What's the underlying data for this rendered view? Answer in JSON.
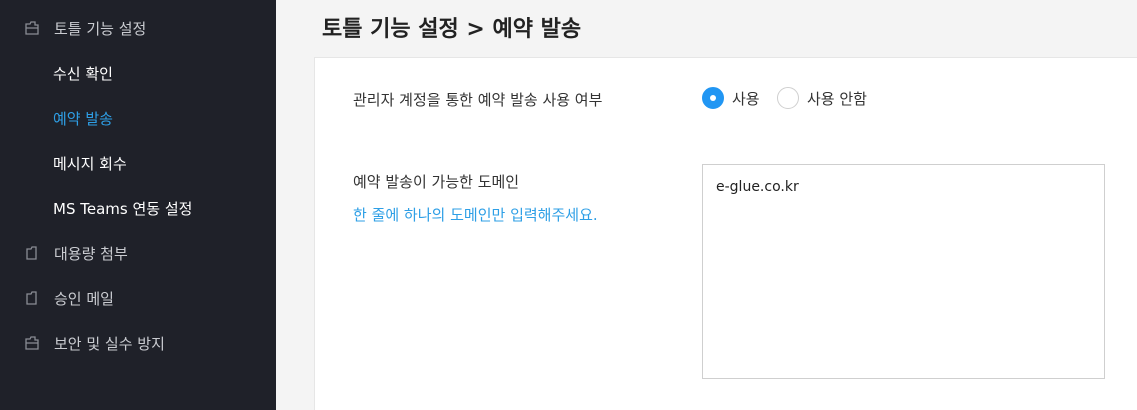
{
  "sidebar": {
    "items": [
      {
        "label": "토틀 기능 설정",
        "icon": "folder-open-icon"
      },
      {
        "label": "대용량 첨부",
        "icon": "folder-icon"
      },
      {
        "label": "승인 메일",
        "icon": "folder-icon"
      },
      {
        "label": "보안 및 실수 방지",
        "icon": "folder-open-icon"
      }
    ],
    "sub_items": [
      {
        "label": "수신 확인",
        "active": false
      },
      {
        "label": "예약 발송",
        "active": true
      },
      {
        "label": "메시지 회수",
        "active": false
      },
      {
        "label": "MS Teams 연동 설정",
        "active": false
      }
    ]
  },
  "header": {
    "title": "토틀 기능 설정 > 예약 발송"
  },
  "settings": {
    "admin_reservation_label": "관리자 계정을 통한 예약 발송 사용 여부",
    "radio_use_label": "사용",
    "radio_not_use_label": "사용 안함",
    "selected": "사용",
    "domain_label": "예약 발송이 가능한 도메인",
    "domain_hint": "한 줄에 하나의 도메인만 입력해주세요.",
    "domain_value": "e-glue.co.kr"
  },
  "colors": {
    "sidebar_bg": "#1f2129",
    "accent": "#2e9fe6"
  }
}
